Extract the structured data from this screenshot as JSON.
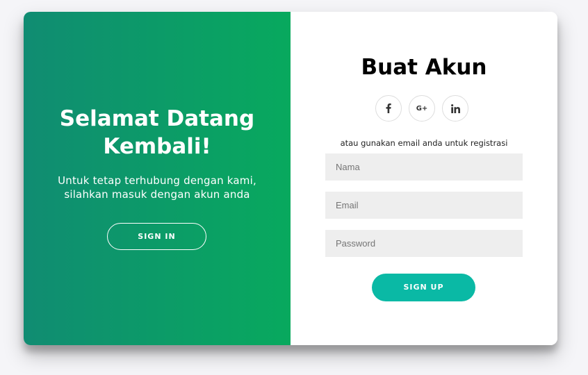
{
  "overlay": {
    "title": "Selamat Datang Kembali!",
    "text": "Untuk tetap terhubung dengan kami, silahkan masuk dengan akun anda",
    "button_label": "SIGN IN"
  },
  "form": {
    "title": "Buat Akun",
    "social": [
      {
        "icon": "facebook-icon"
      },
      {
        "icon": "google-plus-icon",
        "label": "G+"
      },
      {
        "icon": "linkedin-icon"
      }
    ],
    "helper_text": "atau gunakan email anda untuk registrasi",
    "fields": {
      "name_placeholder": "Nama",
      "email_placeholder": "Email",
      "password_placeholder": "Password"
    },
    "button_label": "SIGN UP"
  },
  "colors": {
    "gradient_start": "#108c72",
    "gradient_end": "#08a95e",
    "primary_button": "#0ab9a5",
    "input_background": "#eeeeee"
  }
}
